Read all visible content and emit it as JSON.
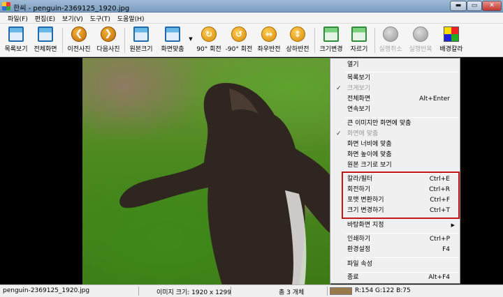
{
  "window": {
    "title": "한씨 - penguin-2369125_1920.jpg",
    "buttons": {
      "minimize": "▬",
      "maximize": "▭",
      "close": "✕"
    }
  },
  "menubar": [
    {
      "label": "파일(F)"
    },
    {
      "label": "편집(E)"
    },
    {
      "label": "보기(V)"
    },
    {
      "label": "도구(T)"
    },
    {
      "label": "도움말(H)"
    }
  ],
  "toolbar": [
    {
      "label": "목록보기",
      "icon": "list-view-icon"
    },
    {
      "label": "전체화면",
      "icon": "fullscreen-icon"
    },
    {
      "label": "이전사진",
      "icon": "previous-arrow-icon",
      "glyph": "❮"
    },
    {
      "label": "다음사진",
      "icon": "next-arrow-icon",
      "glyph": "❯"
    },
    {
      "label": "원본크기",
      "icon": "original-size-icon"
    },
    {
      "label": "화면맞춤",
      "icon": "fit-screen-icon"
    },
    {
      "label": "90° 회전",
      "icon": "rotate-right-icon",
      "glyph": "↻"
    },
    {
      "label": "-90° 회전",
      "icon": "rotate-left-icon",
      "glyph": "↺"
    },
    {
      "label": "좌우반전",
      "icon": "flip-horizontal-icon",
      "glyph": "⇔"
    },
    {
      "label": "상하반전",
      "icon": "flip-vertical-icon",
      "glyph": "⇕"
    },
    {
      "label": "크기변경",
      "icon": "resize-icon"
    },
    {
      "label": "자르기",
      "icon": "crop-icon"
    },
    {
      "label": "실행취소",
      "icon": "undo-icon",
      "disabled": true
    },
    {
      "label": "실행반복",
      "icon": "redo-icon",
      "disabled": true
    },
    {
      "label": "배경칼라",
      "icon": "background-color-icon"
    }
  ],
  "context_menu": {
    "items": [
      {
        "label": "열기"
      },
      {
        "label": "목록보기"
      },
      {
        "label": "크게보기",
        "disabled": true,
        "checked": true
      },
      {
        "label": "전체화면",
        "shortcut": "Alt+Enter"
      },
      {
        "label": "연속보기"
      },
      {
        "label": "큰 이미지만 화면에 맞춤"
      },
      {
        "label": "화면에 맞춤",
        "disabled": true,
        "checked": true
      },
      {
        "label": "화면 너비에 맞춤"
      },
      {
        "label": "화면 높이에 맞춤"
      },
      {
        "label": "원본 크기로 보기"
      },
      {
        "label": "칼라/필터",
        "shortcut": "Ctrl+E"
      },
      {
        "label": "회전하기",
        "shortcut": "Ctrl+R"
      },
      {
        "label": "포맷 변환하기",
        "shortcut": "Ctrl+F"
      },
      {
        "label": "크기 변경하기",
        "shortcut": "Ctrl+T"
      },
      {
        "label": "바탕화면 지정",
        "submenu": "▶"
      },
      {
        "label": "인쇄하기",
        "shortcut": "Ctrl+P"
      },
      {
        "label": "환경설정",
        "shortcut": "F4"
      },
      {
        "label": "파일 속성"
      },
      {
        "label": "종료",
        "shortcut": "Alt+F4"
      }
    ],
    "check_glyph": "✓"
  },
  "statusbar": {
    "filename": "penguin-2369125_1920.jpg",
    "image_size": "이미지 크기: 1920 x 1299",
    "count": "총 3 개체",
    "pixel_color": "R:154 G:122 B:75",
    "swatch_color": "#9a7a4b"
  }
}
